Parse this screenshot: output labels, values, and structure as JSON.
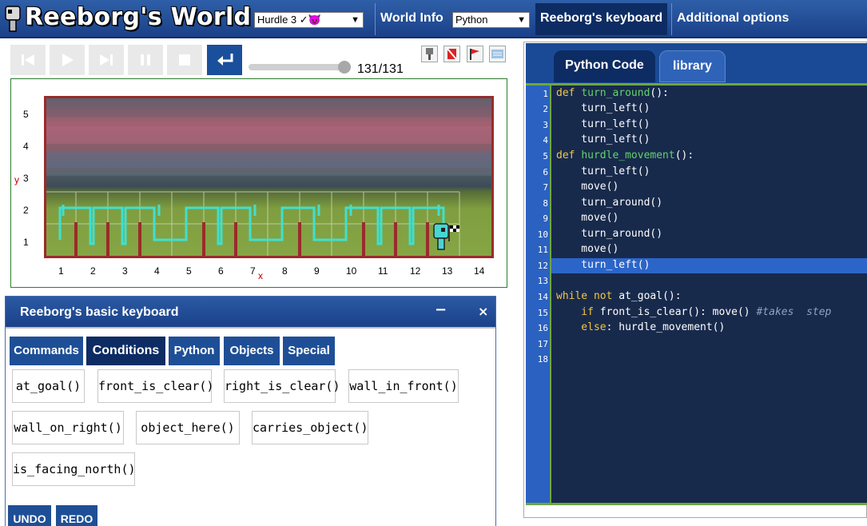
{
  "header": {
    "title": "Reeborg's World",
    "world_selected": "Hurdle 3 ✓😈",
    "world_info_label": "World Info",
    "language_selected": "Python",
    "keyboard_label": "Reeborg's keyboard",
    "options_label": "Additional options"
  },
  "controls": {
    "step_counter": "131/131"
  },
  "world": {
    "x_ticks": [
      "1",
      "2",
      "3",
      "4",
      "5",
      "6",
      "7",
      "8",
      "9",
      "10",
      "11",
      "12",
      "13",
      "14"
    ],
    "y_ticks": [
      "5",
      "4",
      "3",
      "2",
      "1"
    ],
    "x_name": "x",
    "y_name": "y"
  },
  "keyboard": {
    "title": "Reeborg's basic keyboard",
    "minimize": "−",
    "close": "×",
    "tabs": [
      "Commands",
      "Conditions",
      "Python",
      "Objects",
      "Special"
    ],
    "buttons": [
      "at_goal()",
      "front_is_clear()",
      "right_is_clear()",
      "wall_in_front()",
      "wall_on_right()",
      "object_here()",
      "carries_object()",
      "is_facing_north()"
    ],
    "undo": "UNDO",
    "redo": "REDO"
  },
  "editor": {
    "tabs": [
      "Python Code",
      "library"
    ],
    "line_numbers": [
      "1",
      "2",
      "3",
      "4",
      "5",
      "6",
      "7",
      "8",
      "9",
      "10",
      "11",
      "12",
      "13",
      "14",
      "15",
      "16",
      "17",
      "18"
    ],
    "highlighted_line": "12",
    "code": {
      "l1_kw": "def ",
      "l1_fn": "turn_around",
      "l1_rest": "():",
      "l2": "    turn_left()",
      "l3": "    turn_left()",
      "l4": "    turn_left()",
      "l5_kw": "def ",
      "l5_fn": "hurdle_movement",
      "l5_rest": "():",
      "l6": "    turn_left()",
      "l7": "    move()",
      "l8": "    turn_around()",
      "l9": "    move()",
      "l10": "    turn_around()",
      "l11": "    move()",
      "l12": "    turn_left()",
      "l14_kw": "while not ",
      "l14_rest": "at_goal():",
      "l15_kw": "    if ",
      "l15_rest": "front_is_clear(): move() ",
      "l15_cm": "#takes  step",
      "l16_kw": "    else",
      "l16_rest": ": hurdle_movement()"
    }
  }
}
